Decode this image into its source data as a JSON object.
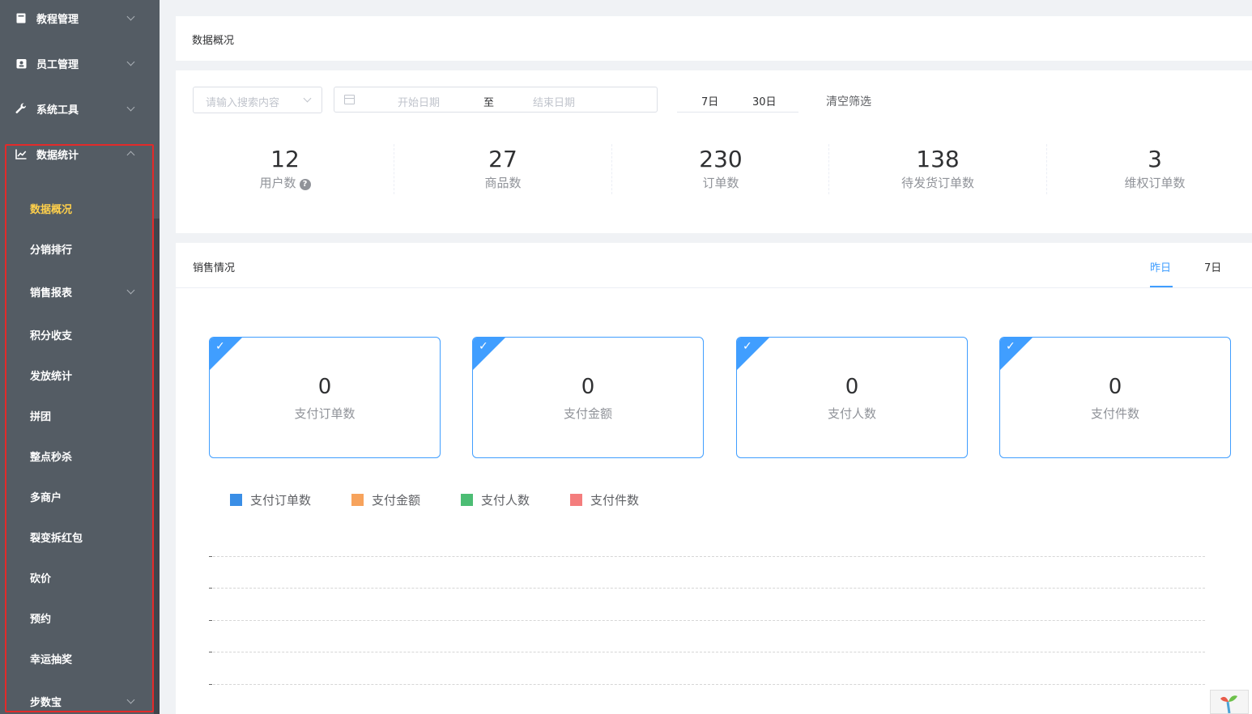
{
  "sidebar": {
    "menus": [
      {
        "label": "教程管理",
        "icon": "book-icon",
        "arrow": "down"
      },
      {
        "label": "员工管理",
        "icon": "id-badge-icon",
        "arrow": "down"
      },
      {
        "label": "系统工具",
        "icon": "wrench-icon",
        "arrow": "down"
      },
      {
        "label": "数据统计",
        "icon": "line-chart-icon",
        "arrow": "up"
      }
    ],
    "sub_items": [
      {
        "label": "数据概况",
        "active": true
      },
      {
        "label": "分销排行"
      },
      {
        "label": "销售报表",
        "has_arrow": true
      },
      {
        "label": "积分收支"
      },
      {
        "label": "发放统计"
      },
      {
        "label": "拼团"
      },
      {
        "label": "整点秒杀"
      },
      {
        "label": "多商户"
      },
      {
        "label": "裂变拆红包"
      },
      {
        "label": "砍价"
      },
      {
        "label": "预约"
      },
      {
        "label": "幸运抽奖"
      },
      {
        "label": "步数宝",
        "has_arrow": true
      }
    ]
  },
  "header": {
    "title": "数据概况"
  },
  "filters": {
    "search_placeholder": "请输入搜索内容",
    "start_placeholder": "开始日期",
    "range_separator": "至",
    "end_placeholder": "结束日期",
    "quick": [
      "7日",
      "30日"
    ],
    "clear_label": "清空筛选"
  },
  "stats": [
    {
      "value": "12",
      "label": "用户数",
      "help": "?"
    },
    {
      "value": "27",
      "label": "商品数"
    },
    {
      "value": "230",
      "label": "订单数"
    },
    {
      "value": "138",
      "label": "待发货订单数"
    },
    {
      "value": "3",
      "label": "维权订单数"
    }
  ],
  "sales": {
    "title": "销售情况",
    "tabs": [
      {
        "label": "昨日",
        "active": true
      },
      {
        "label": "7日"
      }
    ],
    "cards": [
      {
        "value": "0",
        "label": "支付订单数",
        "check": "✓"
      },
      {
        "value": "0",
        "label": "支付金额",
        "check": "✓"
      },
      {
        "value": "0",
        "label": "支付人数",
        "check": "✓"
      },
      {
        "value": "0",
        "label": "支付件数",
        "check": "✓"
      }
    ],
    "legend": [
      {
        "label": "支付订单数",
        "color": "#3a8ee6"
      },
      {
        "label": "支付金额",
        "color": "#f7a35c"
      },
      {
        "label": "支付人数",
        "color": "#4cbd74"
      },
      {
        "label": "支付件数",
        "color": "#f47d7d"
      }
    ]
  },
  "colors": {
    "accent": "#409eff",
    "active_menu": "#ffd04b",
    "sidebar_bg": "#545c64",
    "highlight": "#e32a2a"
  }
}
